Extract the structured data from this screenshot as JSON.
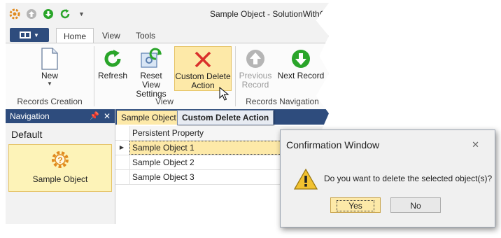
{
  "window": {
    "title": "Sample Object - SolutionWithConfir"
  },
  "quick_access": {
    "icons": [
      "app-gear-icon",
      "back-icon",
      "forward-icon",
      "refresh-icon",
      "customize-qat-icon"
    ]
  },
  "ribbon_tabs": [
    {
      "label": "Home",
      "active": true
    },
    {
      "label": "View",
      "active": false
    },
    {
      "label": "Tools",
      "active": false
    }
  ],
  "ribbon": {
    "groups": [
      {
        "label": "Records Creation",
        "buttons": [
          {
            "label": "New",
            "icon": "document-icon",
            "dropdown": true
          }
        ]
      },
      {
        "label": "View",
        "buttons": [
          {
            "label": "Refresh",
            "icon": "refresh-icon"
          },
          {
            "label": "Reset View\nSettings",
            "icon": "reset-settings-icon"
          },
          {
            "label": "Custom Delete\nAction",
            "icon": "delete-x-icon",
            "highlighted": true
          }
        ]
      },
      {
        "label": "Records Navigation",
        "buttons": [
          {
            "label": "Previous\nRecord",
            "icon": "up-arrow-icon",
            "disabled": true
          },
          {
            "label": "Next Record",
            "icon": "down-arrow-icon"
          }
        ]
      }
    ]
  },
  "navigation": {
    "header": "Navigation",
    "group": "Default",
    "items": [
      {
        "label": "Sample Object",
        "icon": "gear-question-icon",
        "selected": true
      }
    ]
  },
  "document": {
    "tab": "Sample Object",
    "tooltip": "Custom Delete Action",
    "grid": {
      "column": "Persistent Property",
      "rows": [
        "Sample Object 1",
        "Sample Object 2",
        "Sample Object 3"
      ],
      "selected_row": 0
    }
  },
  "dialog": {
    "title": "Confirmation Window",
    "message": "Do you want to delete the selected object(s)?",
    "yes": "Yes",
    "no": "No"
  },
  "colors": {
    "accent": "#2e4c7d",
    "highlight": "#fde9a8",
    "delete": "#d9302b",
    "green": "#2aa52a"
  }
}
